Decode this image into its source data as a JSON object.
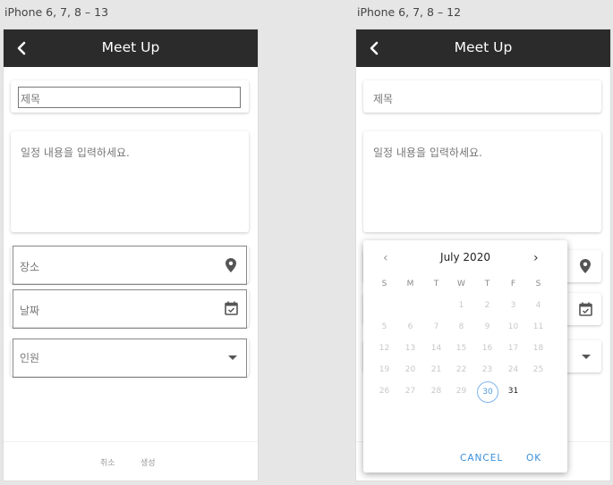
{
  "frames": [
    {
      "label": "iPhone 6, 7, 8 – 13",
      "app_title": "Meet Up",
      "title_placeholder": "제목",
      "content_placeholder": "일정 내용을 입력하세요.",
      "location_placeholder": "장소",
      "date_placeholder": "날짜",
      "people_placeholder": "인원",
      "cancel_label": "취소",
      "create_label": "생성"
    },
    {
      "label": "iPhone 6, 7, 8 – 12",
      "app_title": "Meet Up",
      "title_placeholder": "제목",
      "content_placeholder": "일정 내용을 입력하세요."
    }
  ],
  "date_picker": {
    "month_label": "July 2020",
    "weekdays": [
      "S",
      "M",
      "T",
      "W",
      "T",
      "F",
      "S"
    ],
    "weeks": [
      [
        "",
        "",
        "",
        "1",
        "2",
        "3",
        "4"
      ],
      [
        "5",
        "6",
        "7",
        "8",
        "9",
        "10",
        "11"
      ],
      [
        "12",
        "13",
        "14",
        "15",
        "16",
        "17",
        "18"
      ],
      [
        "19",
        "20",
        "21",
        "22",
        "23",
        "24",
        "25"
      ],
      [
        "26",
        "27",
        "28",
        "29",
        "30",
        "31",
        ""
      ]
    ],
    "selected_day": "30",
    "enabled_day": "31",
    "cancel_label": "CANCEL",
    "ok_label": "OK",
    "accent_color": "#3a8fdd"
  },
  "colors": {
    "appbar": "#2b2b2b",
    "background": "#e6e6e6"
  }
}
